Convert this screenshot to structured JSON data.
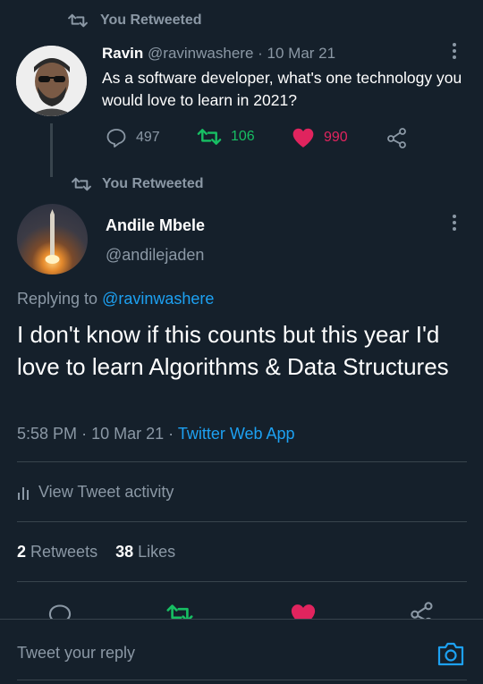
{
  "retweet_header_1": "You Retweeted",
  "tweet1": {
    "name": "Ravin",
    "handle": "@ravinwashere",
    "separator": "·",
    "date": "10 Mar 21",
    "text": "As a software developer, what's one technology you would love to learn in 2021?",
    "replies": "497",
    "retweets": "106",
    "likes": "990"
  },
  "retweet_header_2": "You Retweeted",
  "tweet2": {
    "name": "Andile Mbele",
    "handle": "@andilejaden",
    "replying_prefix": "Replying to",
    "replying_handle": "@ravinwashere",
    "text": "I don't know if this counts but this year I'd love to learn Algorithms & Data Structures",
    "time": "5:58 PM",
    "dot1": "·",
    "date": "10 Mar 21",
    "dot2": "·",
    "source": "Twitter Web App",
    "activity_label": "View Tweet activity",
    "retweet_count": "2",
    "retweet_label": "Retweets",
    "like_count": "38",
    "like_label": "Likes"
  },
  "reply_box": {
    "placeholder": "Tweet your reply"
  },
  "colors": {
    "background": "#15202b",
    "muted": "#8b98a5",
    "link": "#1da1f2",
    "retweet_green": "#17bf63",
    "like_pink": "#e0245e",
    "divider": "#38444d"
  },
  "icons": [
    "retweet-icon",
    "reply-icon",
    "like-icon",
    "share-icon",
    "more-icon",
    "chart-icon",
    "camera-icon"
  ]
}
